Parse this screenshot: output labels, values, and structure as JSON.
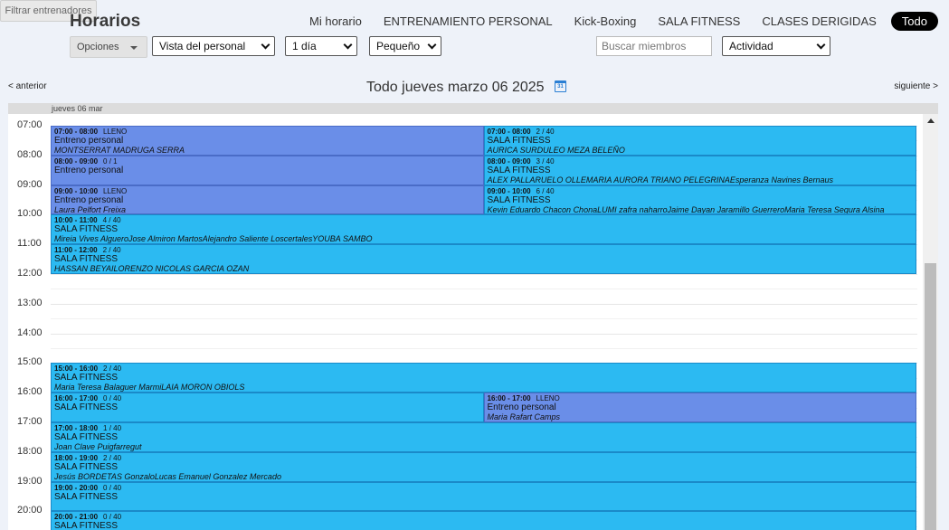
{
  "header": {
    "title": "Horarios"
  },
  "tabs": [
    {
      "label": "Mi horario",
      "active": false
    },
    {
      "label": "ENTRENAMIENTO PERSONAL",
      "active": false
    },
    {
      "label": "Kick-Boxing",
      "active": false
    },
    {
      "label": "SALA FITNESS",
      "active": false
    },
    {
      "label": "CLASES DERIGIDAS",
      "active": false
    },
    {
      "label": "Todo",
      "active": true
    }
  ],
  "toolbar": {
    "opciones_label": "Opciones",
    "vista_value": "Vista del personal",
    "dias_value": "1 día",
    "tamano_value": "Pequeño",
    "search_placeholder": "Buscar miembros",
    "actividad_value": "Actividad",
    "filtrar_label": "Filtrar entrenadores"
  },
  "nav": {
    "prev_label": "< anterior",
    "next_label": "siguiente >",
    "date_title": "Todo jueves marzo 06 2025",
    "calendar_icon_text": "31"
  },
  "day_header": "jueves 06 mar",
  "hours": [
    "07:00",
    "08:00",
    "09:00",
    "10:00",
    "11:00",
    "12:00",
    "13:00",
    "14:00",
    "15:00",
    "16:00",
    "17:00",
    "18:00",
    "19:00",
    "20:00"
  ],
  "colors": {
    "fitness": "#2cbaf2",
    "personal": "#6a8ee8",
    "active_tab": "#000000"
  },
  "events": [
    {
      "start": "07:00",
      "end": "08:00",
      "time": "07:00 - 08:00",
      "cap": "LLENO",
      "name": "Entreno personal",
      "members": "MONTSERRAT MADRUGA SERRA",
      "type": "personal",
      "col": 0,
      "cols": 2
    },
    {
      "start": "07:00",
      "end": "08:00",
      "time": "07:00 - 08:00",
      "cap": "2 / 40",
      "name": "SALA FITNESS",
      "members": "AURICA SURDULEO MEZA BELEÑO",
      "type": "fitness",
      "col": 1,
      "cols": 2
    },
    {
      "start": "08:00",
      "end": "09:00",
      "time": "08:00 - 09:00",
      "cap": "0 / 1",
      "name": "Entreno personal",
      "members": "",
      "type": "personal",
      "col": 0,
      "cols": 2
    },
    {
      "start": "08:00",
      "end": "09:00",
      "time": "08:00 - 09:00",
      "cap": "3 / 40",
      "name": "SALA FITNESS",
      "members": "ALEX PALLARUELO OLLEMARIA AURORA TRIANO PELEGRINAEsperanza Navines Bernaus",
      "type": "fitness",
      "col": 1,
      "cols": 2
    },
    {
      "start": "09:00",
      "end": "10:00",
      "time": "09:00 - 10:00",
      "cap": "LLENO",
      "name": "Entreno personal",
      "members": "Laura Pelfort Freixa",
      "type": "personal",
      "col": 0,
      "cols": 2
    },
    {
      "start": "09:00",
      "end": "10:00",
      "time": "09:00 - 10:00",
      "cap": "6 / 40",
      "name": "SALA FITNESS",
      "members": "Kevin Eduardo Chacon ChonaLUMI zafra naharroJaime Dayan Jaramillo GuerreroMaria Teresa Segura Alsina",
      "type": "fitness",
      "col": 1,
      "cols": 2
    },
    {
      "start": "10:00",
      "end": "11:00",
      "time": "10:00 - 11:00",
      "cap": "4 / 40",
      "name": "SALA FITNESS",
      "members": "Mireia Vives AlgueroJose Almiron MartosAlejandro Saliente LoscertalesYOUBA SAMBO",
      "type": "fitness",
      "col": 0,
      "cols": 1
    },
    {
      "start": "11:00",
      "end": "12:00",
      "time": "11:00 - 12:00",
      "cap": "2 / 40",
      "name": "SALA FITNESS",
      "members": "HASSAN BEYAILORENZO NICOLAS GARCIA OZAN",
      "type": "fitness",
      "col": 0,
      "cols": 1
    },
    {
      "start": "15:00",
      "end": "16:00",
      "time": "15:00 - 16:00",
      "cap": "2 / 40",
      "name": "SALA FITNESS",
      "members": "Maria Teresa Balaguer MarmiLAIA MORON OBIOLS",
      "type": "fitness",
      "col": 0,
      "cols": 1
    },
    {
      "start": "16:00",
      "end": "17:00",
      "time": "16:00 - 17:00",
      "cap": "0 / 40",
      "name": "SALA FITNESS",
      "members": "",
      "type": "fitness",
      "col": 0,
      "cols": 2
    },
    {
      "start": "16:00",
      "end": "17:00",
      "time": "16:00 - 17:00",
      "cap": "LLENO",
      "name": "Entreno personal",
      "members": "Maria Rafart Camps",
      "type": "personal",
      "col": 1,
      "cols": 2
    },
    {
      "start": "17:00",
      "end": "18:00",
      "time": "17:00 - 18:00",
      "cap": "1 / 40",
      "name": "SALA FITNESS",
      "members": "Joan Clave Puigfarregut",
      "type": "fitness",
      "col": 0,
      "cols": 1
    },
    {
      "start": "18:00",
      "end": "19:00",
      "time": "18:00 - 19:00",
      "cap": "2 / 40",
      "name": "SALA FITNESS",
      "members": "Jesús BORDETAS GonzaloLucas Emanuel Gonzalez Mercado",
      "type": "fitness",
      "col": 0,
      "cols": 1
    },
    {
      "start": "19:00",
      "end": "20:00",
      "time": "19:00 - 20:00",
      "cap": "0 / 40",
      "name": "SALA FITNESS",
      "members": "",
      "type": "fitness",
      "col": 0,
      "cols": 1
    },
    {
      "start": "20:00",
      "end": "21:00",
      "time": "20:00 - 21:00",
      "cap": "0 / 40",
      "name": "SALA FITNESS",
      "members": "",
      "type": "fitness",
      "col": 0,
      "cols": 1
    }
  ]
}
